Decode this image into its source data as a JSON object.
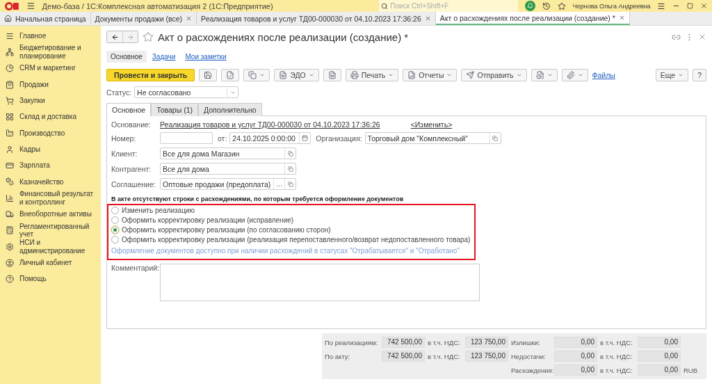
{
  "app": {
    "title": "Демо-база / 1С:Комплексная автоматизация 2  (1С:Предприятие)",
    "search_placeholder": "Поиск Ctrl+Shift+F",
    "user": "Чернова Ольга Андреевна"
  },
  "open_tabs": [
    {
      "label": "Начальная страница",
      "selected": false,
      "closable": false
    },
    {
      "label": "Документы продажи (все)",
      "selected": false,
      "closable": true
    },
    {
      "label": "Реализация товаров и услуг ТД00-000030 от 04.10.2023 17:36:26",
      "selected": false,
      "closable": true
    },
    {
      "label": "Акт о расхождениях после реализации (создание) *",
      "selected": true,
      "closable": true
    }
  ],
  "sidebar": {
    "items": [
      {
        "label": "Главное"
      },
      {
        "label": "Бюджетирование и планирование"
      },
      {
        "label": "CRM и маркетинг"
      },
      {
        "label": "Продажи"
      },
      {
        "label": "Закупки"
      },
      {
        "label": "Склад и доставка"
      },
      {
        "label": "Производство"
      },
      {
        "label": "Кадры"
      },
      {
        "label": "Зарплата"
      },
      {
        "label": "Казначейство"
      },
      {
        "label": "Финансовый результат и контроллинг"
      },
      {
        "label": "Внеоборотные активы"
      },
      {
        "label": "Регламентированный учет"
      },
      {
        "label": "НСИ и администрирование"
      },
      {
        "label": "Личный кабинет"
      },
      {
        "label": "Помощь"
      }
    ]
  },
  "form": {
    "title": "Акт о расхождениях после реализации (создание) *",
    "sections": [
      {
        "label": "Основное",
        "selected": true
      },
      {
        "label": "Задачи",
        "selected": false
      },
      {
        "label": "Мои заметки",
        "selected": false
      }
    ],
    "toolbar": [
      {
        "kind": "primary",
        "label": "Провести и закрыть"
      },
      {
        "kind": "icon"
      },
      {
        "kind": "icon"
      },
      {
        "kind": "menu"
      },
      {
        "kind": "menu",
        "label": "ЭДО"
      },
      {
        "kind": "icon"
      },
      {
        "kind": "menu",
        "label": "Печать"
      },
      {
        "kind": "menu",
        "label": "Отчеты"
      },
      {
        "kind": "menu",
        "label": "Отправить"
      },
      {
        "kind": "menu"
      },
      {
        "kind": "menu"
      },
      {
        "kind": "link",
        "label": "Файлы"
      }
    ],
    "more_button": "Еще",
    "help_button": "?",
    "status": {
      "label": "Статус:",
      "value": "Не согласовано"
    },
    "tabs": [
      {
        "label": "Основное",
        "selected": true
      },
      {
        "label": "Товары (1)",
        "selected": false
      },
      {
        "label": "Дополнительно",
        "selected": false
      }
    ],
    "basis": {
      "label": "Основание:",
      "value": "Реализация товаров и услуг ТД00-000030 от 04.10.2023 17:36:26",
      "change_link": "<Изменить>"
    },
    "number": {
      "label": "Номер:",
      "date_label": "от:",
      "date": "24.10.2025  0:00:00"
    },
    "organization": {
      "label": "Организация:",
      "value": "Торговый дом \"Комплексный\""
    },
    "fields": [
      {
        "label": "Клиент:",
        "value": "Все для дома Магазин",
        "kind": "open"
      },
      {
        "label": "Контрагент:",
        "value": "Все для дома",
        "kind": "open"
      },
      {
        "label": "Соглашение:",
        "value": "Оптовые продажи (предоплата)",
        "kind": "choose",
        "choose_button": "..."
      }
    ],
    "notice": "В акте отсутствуют строки с расхождениями, по которым требуется оформление документов",
    "options": [
      {
        "label": "Изменить реализацию",
        "selected": false
      },
      {
        "label": "Оформить корректировку реализации (исправление)",
        "selected": false
      },
      {
        "label": "Оформить корректировку реализации (по согласованию сторон)",
        "selected": true
      },
      {
        "label": "Оформить корректировку реализации (реализация перепоставленного/возврат недопоставленного товара)",
        "selected": false
      }
    ],
    "hint": "Оформление документов доступно при наличии расхождений в статусах \"Отрабатывается\" и \"Отработано\"",
    "comment_label": "Комментарий:"
  },
  "totals": {
    "rows": [
      {
        "label": "По реализациям:",
        "amount": "742 500,00",
        "vat_label": "в т.ч. НДС:",
        "vat": "123 750,00",
        "label2": "Излишки:",
        "amount2": "0,00",
        "vat_label2": "в т.ч. НДС:",
        "vat2": "0,00"
      },
      {
        "label": "По акту:",
        "amount": "742 500,00",
        "vat_label": "в т.ч. НДС:",
        "vat": "123 750,00",
        "label2": "Недостачи:",
        "amount2": "0,00",
        "vat_label2": "в т.ч. НДС:",
        "vat2": "0,00"
      },
      {
        "label2": "Расхождения:",
        "amount2": "0,00",
        "vat_label2": "в т.ч. НДС:",
        "vat2": "0,00",
        "currency": "RUB"
      }
    ]
  }
}
